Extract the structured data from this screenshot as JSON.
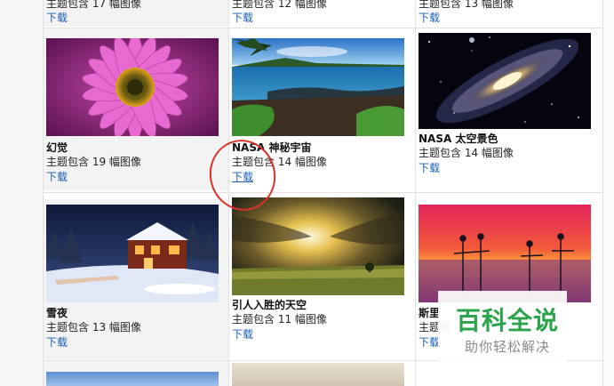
{
  "top_row": [
    {
      "count": "主题包含 17 幅图像",
      "download": "下载"
    },
    {
      "count": "主题包含 12 幅图像",
      "download": "下载"
    },
    {
      "count": "主题包含 13 幅图像",
      "download": "下载"
    }
  ],
  "themes": [
    {
      "title": "幻觉",
      "count": "主题包含 19 幅图像",
      "download": "下载",
      "thumb": "pink-daisy-flower"
    },
    {
      "title": "NASA 神秘宇宙",
      "count": "主题包含 14 幅图像",
      "download": "下载",
      "thumb": "rocky-coast-sea"
    },
    {
      "title": "NASA 太空景色",
      "count": "主题包含 14 幅图像",
      "download": "下载",
      "thumb": "spiral-galaxy"
    },
    {
      "title": "雪夜",
      "count": "主题包含 13 幅图像",
      "download": "下载",
      "thumb": "snowy-cabin-night"
    },
    {
      "title": "引人入胜的天空",
      "count": "主题包含 11 幅图像",
      "download": "下载",
      "thumb": "sunburst-sky-field"
    },
    {
      "title": "斯里",
      "count": "主题包",
      "download": "下载",
      "thumb": "stilt-fishermen-sunset"
    }
  ],
  "watermark": {
    "main": "百科全说",
    "sub": "助你轻松解决"
  },
  "colors": {
    "link": "#1a5fb4",
    "highlight_circle": "#d9322b",
    "watermark_green": "#2aa34a"
  }
}
